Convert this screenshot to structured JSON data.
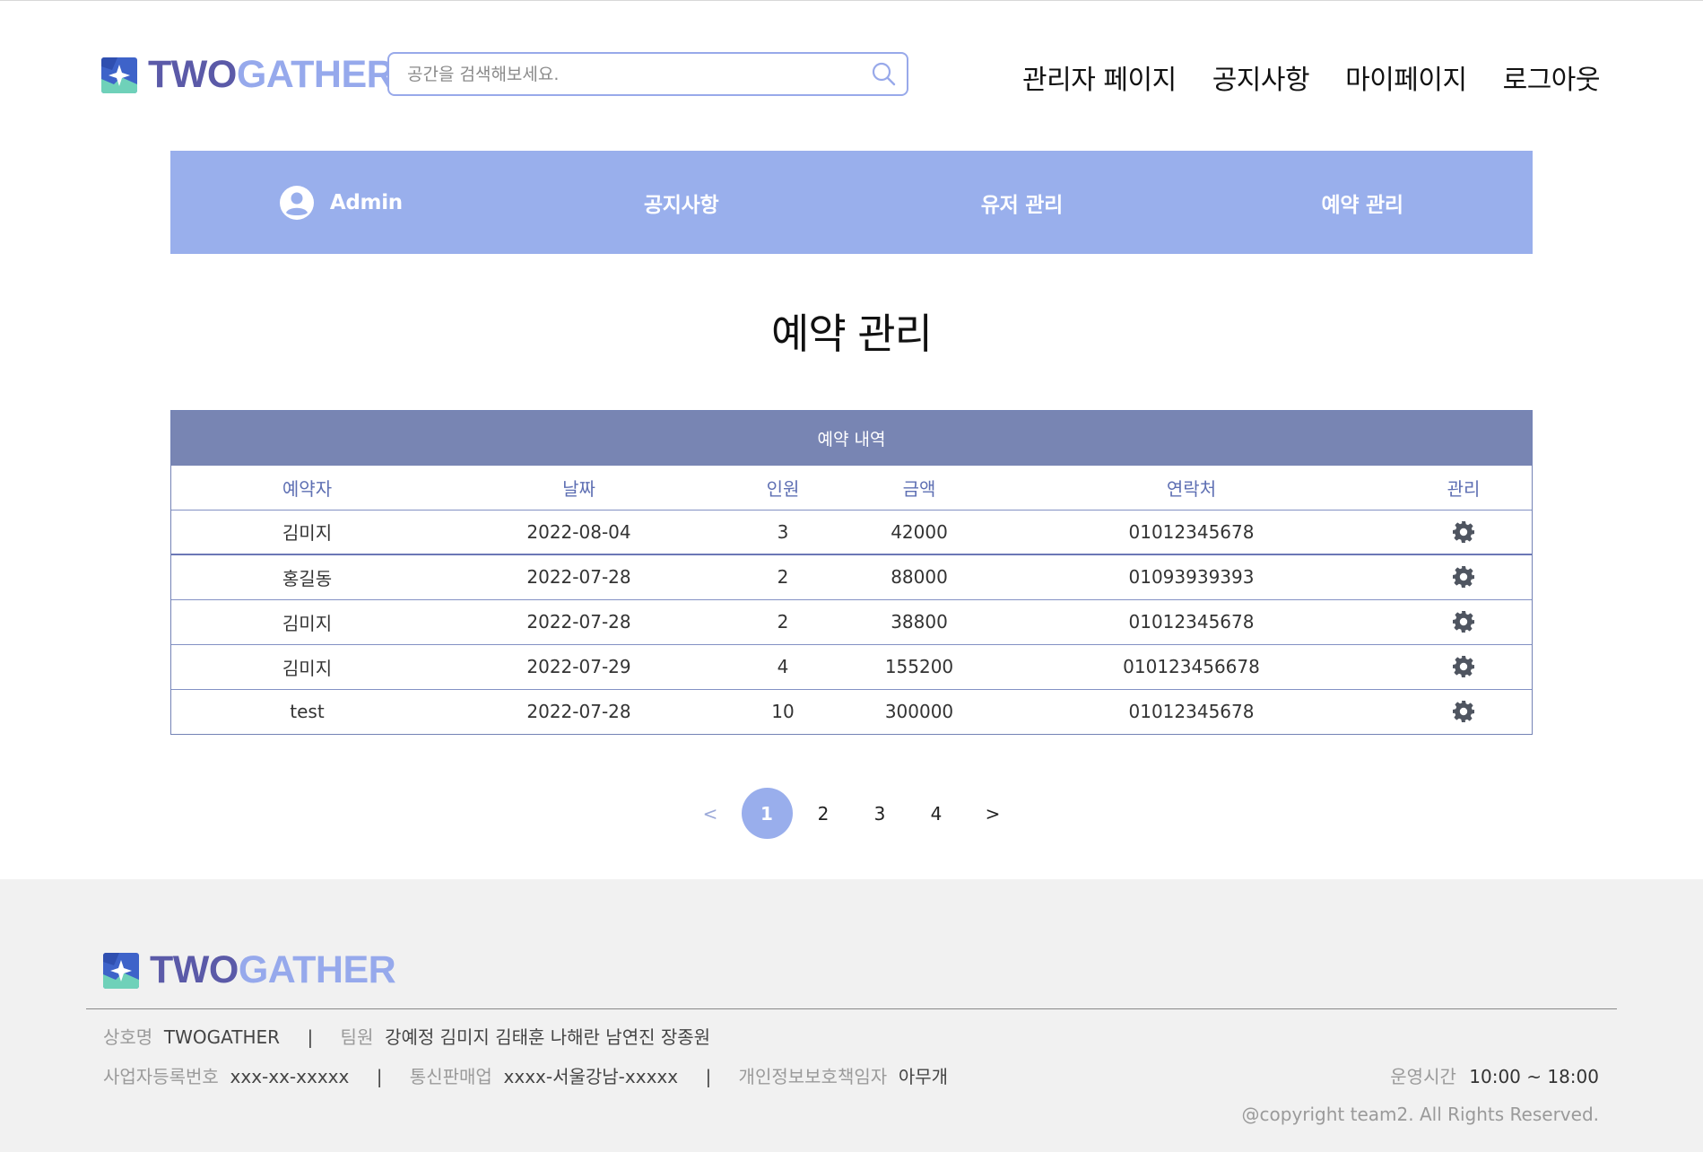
{
  "header": {
    "brand_part1": "TWO",
    "brand_part2": "GATHER",
    "search_placeholder": "공간을 검색해보세요.",
    "nav": [
      "관리자 페이지",
      "공지사항",
      "마이페이지",
      "로그아웃"
    ]
  },
  "admin_bar": {
    "user_label": "Admin",
    "menu": [
      "공지사항",
      "유저 관리",
      "예약 관리"
    ]
  },
  "page_title": "예약 관리",
  "table": {
    "caption": "예약 내역",
    "columns": [
      "예약자",
      "날짜",
      "인원",
      "금액",
      "연락처",
      "관리"
    ],
    "rows": [
      [
        "김미지",
        "2022-08-04",
        "3",
        "42000",
        "01012345678"
      ],
      [
        "홍길동",
        "2022-07-28",
        "2",
        "88000",
        "01093939393"
      ],
      [
        "김미지",
        "2022-07-28",
        "2",
        "38800",
        "01012345678"
      ],
      [
        "김미지",
        "2022-07-29",
        "4",
        "155200",
        "010123456678"
      ],
      [
        "test",
        "2022-07-28",
        "10",
        "300000",
        "01012345678"
      ]
    ],
    "row_action_icon": "gear-icon"
  },
  "pagination": {
    "prev": "<",
    "pages": [
      "1",
      "2",
      "3",
      "4"
    ],
    "current": "1",
    "next": ">"
  },
  "footer": {
    "brand_part1": "TWO",
    "brand_part2": "GATHER",
    "company_label": "상호명",
    "company_value": "TWOGATHER",
    "team_label": "팀원",
    "team_value": "강예정 김미지 김태훈 나해란 남연진 장종원",
    "biz_label": "사업자등록번호",
    "biz_value": "xxx-xx-xxxxx",
    "ecom_label": "통신판매업",
    "ecom_value": "xxxx-서울강남-xxxxx",
    "privacy_label": "개인정보보호책임자",
    "privacy_value": "아무개",
    "hours_label": "운영시간",
    "hours_value": "10:00 ~ 18:00",
    "copyright": "@copyright team2. All Rights Reserved.",
    "separator": "|"
  },
  "colors": {
    "accent": "#99afec",
    "brand_dark": "#5b5aa8",
    "table_header": "#7885b3",
    "footer_bg": "#f1f1f1"
  }
}
